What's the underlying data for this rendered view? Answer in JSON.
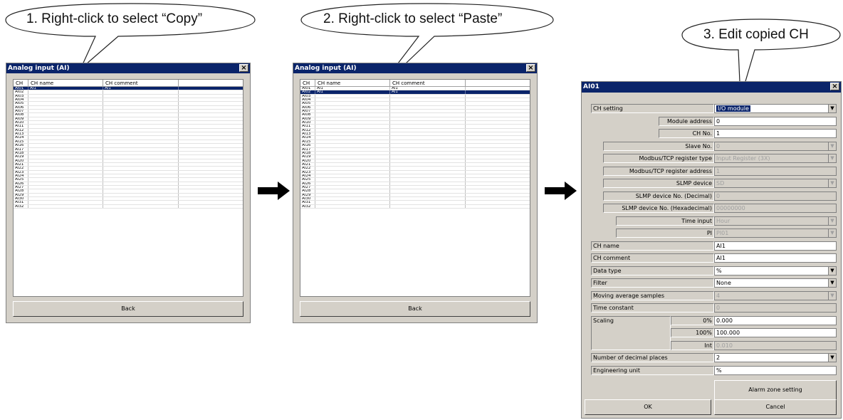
{
  "callouts": {
    "step1": "1. Right-click to select “Copy”",
    "step2": "2. Right-click to select “Paste”",
    "step3": "3. Edit copied CH"
  },
  "list_window": {
    "title": "Analog input (AI)",
    "close": "×",
    "headers": [
      "CH",
      "CH name",
      "CH comment"
    ],
    "back_label": "Back"
  },
  "window1": {
    "rows": [
      {
        "ch": "AI01",
        "name": "AI1",
        "comment": "AI1",
        "selected": true
      },
      {
        "ch": "AI02"
      },
      {
        "ch": "AI03"
      },
      {
        "ch": "AI04"
      },
      {
        "ch": "AI05"
      },
      {
        "ch": "AI06"
      },
      {
        "ch": "AI07"
      },
      {
        "ch": "AI08"
      },
      {
        "ch": "AI09"
      },
      {
        "ch": "AI10"
      },
      {
        "ch": "AI11"
      },
      {
        "ch": "AI12"
      },
      {
        "ch": "AI13"
      },
      {
        "ch": "AI14"
      },
      {
        "ch": "AI15"
      },
      {
        "ch": "AI16"
      },
      {
        "ch": "AI17"
      },
      {
        "ch": "AI18"
      },
      {
        "ch": "AI19"
      },
      {
        "ch": "AI20"
      },
      {
        "ch": "AI21"
      },
      {
        "ch": "AI22"
      },
      {
        "ch": "AI23"
      },
      {
        "ch": "AI24"
      },
      {
        "ch": "AI25"
      },
      {
        "ch": "AI26"
      },
      {
        "ch": "AI27"
      },
      {
        "ch": "AI28"
      },
      {
        "ch": "AI29"
      },
      {
        "ch": "AI30"
      },
      {
        "ch": "AI31"
      },
      {
        "ch": "AI32"
      }
    ]
  },
  "window2": {
    "rows": [
      {
        "ch": "AI01",
        "name": "AI1",
        "comment": "AI1"
      },
      {
        "ch": "AI02",
        "name": "AI1",
        "comment": "AI1",
        "selected": true
      },
      {
        "ch": "AI03"
      },
      {
        "ch": "AI04"
      },
      {
        "ch": "AI05"
      },
      {
        "ch": "AI06"
      },
      {
        "ch": "AI07"
      },
      {
        "ch": "AI08"
      },
      {
        "ch": "AI09"
      },
      {
        "ch": "AI10"
      },
      {
        "ch": "AI11"
      },
      {
        "ch": "AI12"
      },
      {
        "ch": "AI13"
      },
      {
        "ch": "AI14"
      },
      {
        "ch": "AI15"
      },
      {
        "ch": "AI16"
      },
      {
        "ch": "AI17"
      },
      {
        "ch": "AI18"
      },
      {
        "ch": "AI19"
      },
      {
        "ch": "AI20"
      },
      {
        "ch": "AI21"
      },
      {
        "ch": "AI22"
      },
      {
        "ch": "AI23"
      },
      {
        "ch": "AI24"
      },
      {
        "ch": "AI25"
      },
      {
        "ch": "AI26"
      },
      {
        "ch": "AI27"
      },
      {
        "ch": "AI28"
      },
      {
        "ch": "AI29"
      },
      {
        "ch": "AI30"
      },
      {
        "ch": "AI31"
      },
      {
        "ch": "AI32"
      }
    ]
  },
  "settings": {
    "title": "AI01",
    "close": "×",
    "ch_setting_label": "CH setting",
    "ch_setting_value": "I/O module",
    "module_address_label": "Module address",
    "module_address_value": "0",
    "ch_no_label": "CH No.",
    "ch_no_value": "1",
    "slave_no_label": "Slave No.",
    "slave_no_value": "0",
    "modbus_reg_type_label": "Modbus/TCP register type",
    "modbus_reg_type_value": "Input Register (3X)",
    "modbus_reg_addr_label": "Modbus/TCP register address",
    "modbus_reg_addr_value": "1",
    "slmp_device_label": "SLMP device",
    "slmp_device_value": "SD",
    "slmp_dec_label": "SLMP device No. (Decimal)",
    "slmp_dec_value": "0",
    "slmp_hex_label": "SLMP device No. (Hexadecimal)",
    "slmp_hex_value": "00000000",
    "time_input_label": "Time input",
    "time_input_value": "Hour",
    "pi_label": "PI",
    "pi_value": "PI01",
    "ch_name_label": "CH name",
    "ch_name_value": "AI1",
    "ch_comment_label": "CH comment",
    "ch_comment_value": "AI1",
    "data_type_label": "Data type",
    "data_type_value": "%",
    "filter_label": "Filter",
    "filter_value": "None",
    "moving_avg_label": "Moving average samples",
    "moving_avg_value": "4",
    "time_constant_label": "Time constant",
    "time_constant_value": "0",
    "scaling_label": "Scaling",
    "scaling_0_label": "0%",
    "scaling_0_value": "0.000",
    "scaling_100_label": "100%",
    "scaling_100_value": "100.000",
    "scaling_int_label": "Int",
    "scaling_int_value": "0.010",
    "decimal_places_label": "Number of decimal places",
    "decimal_places_value": "2",
    "eng_unit_label": "Engineering unit",
    "eng_unit_value": "%",
    "alarm_zone_label": "Alarm zone setting",
    "ok_label": "OK",
    "cancel_label": "Cancel"
  }
}
